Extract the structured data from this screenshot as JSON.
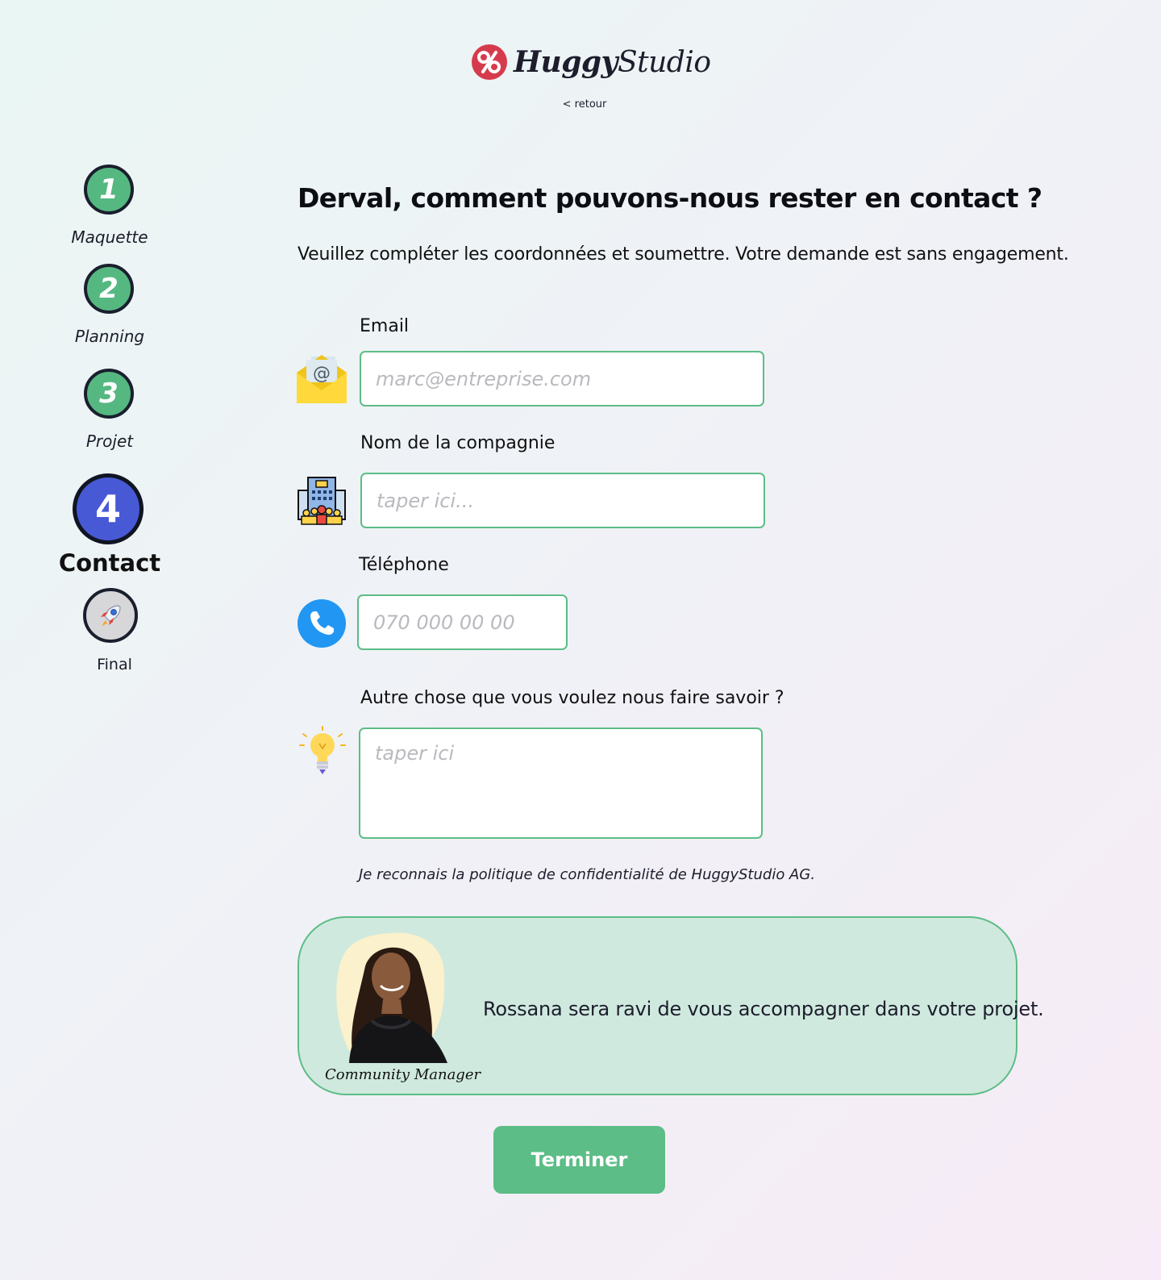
{
  "brand": {
    "name_bold": "Huggy",
    "name_regular": "Studio",
    "back_link": "< retour"
  },
  "steps": [
    {
      "number": "1",
      "label": "Maquette",
      "state": "done"
    },
    {
      "number": "2",
      "label": "Planning",
      "state": "done"
    },
    {
      "number": "3",
      "label": "Projet",
      "state": "done"
    },
    {
      "number": "4",
      "label": "Contact",
      "state": "active"
    },
    {
      "number": "",
      "label": "Final",
      "state": "pending",
      "icon": "rocket-icon"
    }
  ],
  "form": {
    "title": "Derval, comment pouvons-nous rester en contact ?",
    "subtitle": "Veuillez compléter les coordonnées et soumettre. Votre demande est sans engagement.",
    "email": {
      "label": "Email",
      "placeholder": "marc@entreprise.com",
      "icon": "email-envelope-icon"
    },
    "company": {
      "label": "Nom de la compagnie",
      "placeholder": "taper ici...",
      "icon": "office-building-icon"
    },
    "phone": {
      "label": "Téléphone",
      "placeholder": "070 000 00 00",
      "icon": "phone-icon"
    },
    "message": {
      "label": "Autre chose que vous voulez nous faire savoir ?",
      "placeholder": "taper ici",
      "icon": "lightbulb-icon"
    },
    "privacy": "Je reconnais la politique de confidentialité de HuggyStudio AG."
  },
  "contact_card": {
    "role": "Community Manager",
    "message": "Rossana sera ravi de vous accompagner dans votre projet."
  },
  "submit_label": "Terminer",
  "colors": {
    "accent_green": "#5cbd86",
    "active_blue": "#4859d6",
    "brand_red": "#d63b4d",
    "card_bg": "#cfe9de"
  }
}
